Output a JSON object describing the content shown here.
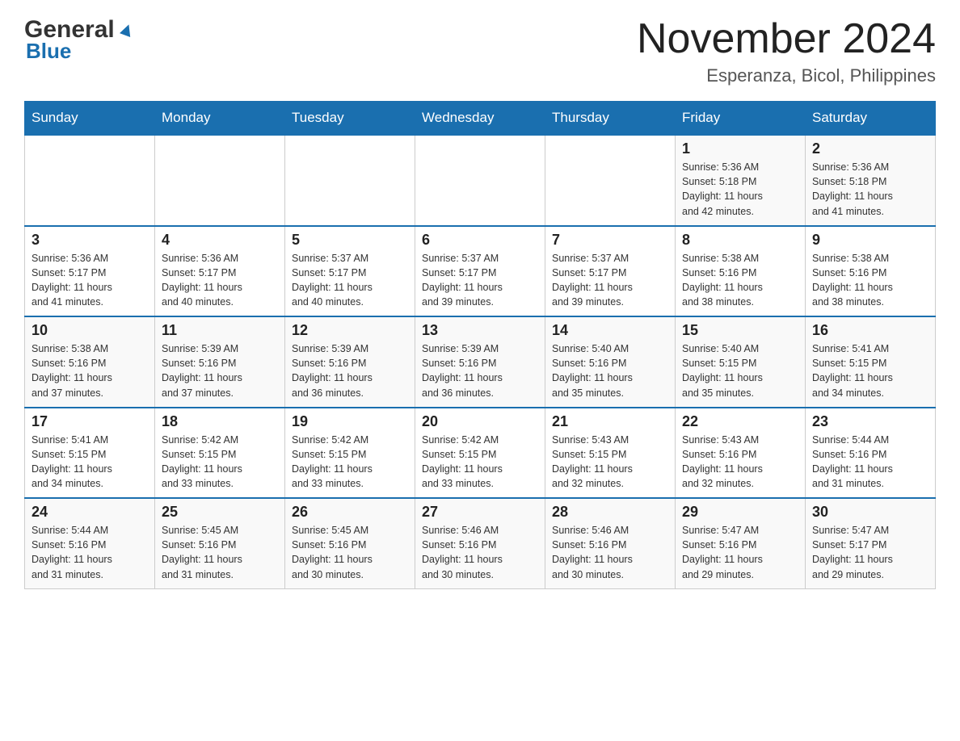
{
  "header": {
    "logo": {
      "general": "General",
      "blue": "Blue"
    },
    "title": "November 2024",
    "location": "Esperanza, Bicol, Philippines"
  },
  "calendar": {
    "days_of_week": [
      "Sunday",
      "Monday",
      "Tuesday",
      "Wednesday",
      "Thursday",
      "Friday",
      "Saturday"
    ],
    "weeks": [
      [
        {
          "day": "",
          "info": ""
        },
        {
          "day": "",
          "info": ""
        },
        {
          "day": "",
          "info": ""
        },
        {
          "day": "",
          "info": ""
        },
        {
          "day": "",
          "info": ""
        },
        {
          "day": "1",
          "info": "Sunrise: 5:36 AM\nSunset: 5:18 PM\nDaylight: 11 hours\nand 42 minutes."
        },
        {
          "day": "2",
          "info": "Sunrise: 5:36 AM\nSunset: 5:18 PM\nDaylight: 11 hours\nand 41 minutes."
        }
      ],
      [
        {
          "day": "3",
          "info": "Sunrise: 5:36 AM\nSunset: 5:17 PM\nDaylight: 11 hours\nand 41 minutes."
        },
        {
          "day": "4",
          "info": "Sunrise: 5:36 AM\nSunset: 5:17 PM\nDaylight: 11 hours\nand 40 minutes."
        },
        {
          "day": "5",
          "info": "Sunrise: 5:37 AM\nSunset: 5:17 PM\nDaylight: 11 hours\nand 40 minutes."
        },
        {
          "day": "6",
          "info": "Sunrise: 5:37 AM\nSunset: 5:17 PM\nDaylight: 11 hours\nand 39 minutes."
        },
        {
          "day": "7",
          "info": "Sunrise: 5:37 AM\nSunset: 5:17 PM\nDaylight: 11 hours\nand 39 minutes."
        },
        {
          "day": "8",
          "info": "Sunrise: 5:38 AM\nSunset: 5:16 PM\nDaylight: 11 hours\nand 38 minutes."
        },
        {
          "day": "9",
          "info": "Sunrise: 5:38 AM\nSunset: 5:16 PM\nDaylight: 11 hours\nand 38 minutes."
        }
      ],
      [
        {
          "day": "10",
          "info": "Sunrise: 5:38 AM\nSunset: 5:16 PM\nDaylight: 11 hours\nand 37 minutes."
        },
        {
          "day": "11",
          "info": "Sunrise: 5:39 AM\nSunset: 5:16 PM\nDaylight: 11 hours\nand 37 minutes."
        },
        {
          "day": "12",
          "info": "Sunrise: 5:39 AM\nSunset: 5:16 PM\nDaylight: 11 hours\nand 36 minutes."
        },
        {
          "day": "13",
          "info": "Sunrise: 5:39 AM\nSunset: 5:16 PM\nDaylight: 11 hours\nand 36 minutes."
        },
        {
          "day": "14",
          "info": "Sunrise: 5:40 AM\nSunset: 5:16 PM\nDaylight: 11 hours\nand 35 minutes."
        },
        {
          "day": "15",
          "info": "Sunrise: 5:40 AM\nSunset: 5:15 PM\nDaylight: 11 hours\nand 35 minutes."
        },
        {
          "day": "16",
          "info": "Sunrise: 5:41 AM\nSunset: 5:15 PM\nDaylight: 11 hours\nand 34 minutes."
        }
      ],
      [
        {
          "day": "17",
          "info": "Sunrise: 5:41 AM\nSunset: 5:15 PM\nDaylight: 11 hours\nand 34 minutes."
        },
        {
          "day": "18",
          "info": "Sunrise: 5:42 AM\nSunset: 5:15 PM\nDaylight: 11 hours\nand 33 minutes."
        },
        {
          "day": "19",
          "info": "Sunrise: 5:42 AM\nSunset: 5:15 PM\nDaylight: 11 hours\nand 33 minutes."
        },
        {
          "day": "20",
          "info": "Sunrise: 5:42 AM\nSunset: 5:15 PM\nDaylight: 11 hours\nand 33 minutes."
        },
        {
          "day": "21",
          "info": "Sunrise: 5:43 AM\nSunset: 5:15 PM\nDaylight: 11 hours\nand 32 minutes."
        },
        {
          "day": "22",
          "info": "Sunrise: 5:43 AM\nSunset: 5:16 PM\nDaylight: 11 hours\nand 32 minutes."
        },
        {
          "day": "23",
          "info": "Sunrise: 5:44 AM\nSunset: 5:16 PM\nDaylight: 11 hours\nand 31 minutes."
        }
      ],
      [
        {
          "day": "24",
          "info": "Sunrise: 5:44 AM\nSunset: 5:16 PM\nDaylight: 11 hours\nand 31 minutes."
        },
        {
          "day": "25",
          "info": "Sunrise: 5:45 AM\nSunset: 5:16 PM\nDaylight: 11 hours\nand 31 minutes."
        },
        {
          "day": "26",
          "info": "Sunrise: 5:45 AM\nSunset: 5:16 PM\nDaylight: 11 hours\nand 30 minutes."
        },
        {
          "day": "27",
          "info": "Sunrise: 5:46 AM\nSunset: 5:16 PM\nDaylight: 11 hours\nand 30 minutes."
        },
        {
          "day": "28",
          "info": "Sunrise: 5:46 AM\nSunset: 5:16 PM\nDaylight: 11 hours\nand 30 minutes."
        },
        {
          "day": "29",
          "info": "Sunrise: 5:47 AM\nSunset: 5:16 PM\nDaylight: 11 hours\nand 29 minutes."
        },
        {
          "day": "30",
          "info": "Sunrise: 5:47 AM\nSunset: 5:17 PM\nDaylight: 11 hours\nand 29 minutes."
        }
      ]
    ]
  }
}
